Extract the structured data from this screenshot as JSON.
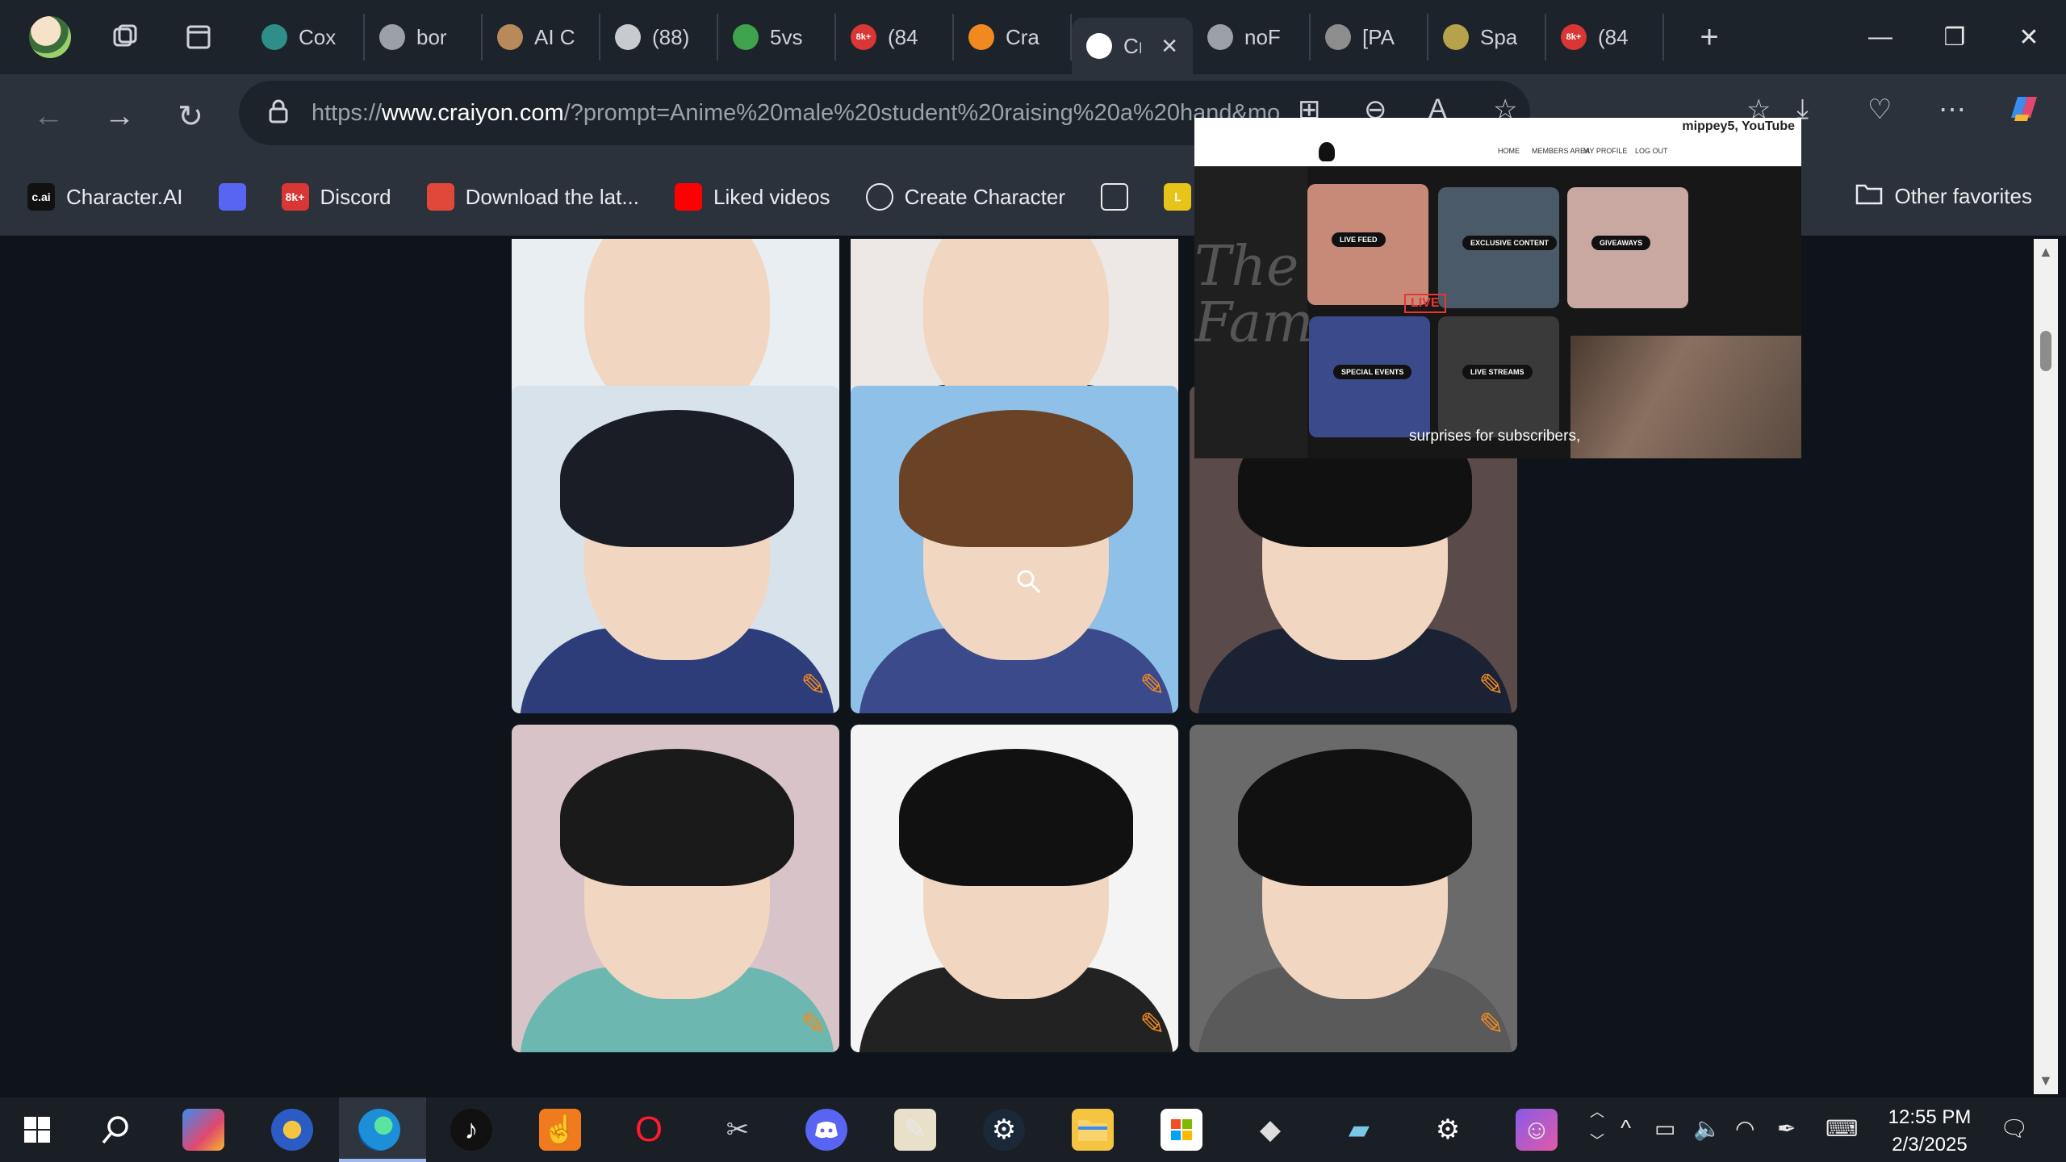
{
  "browser": {
    "tabs": [
      {
        "label": "Cox",
        "icon": "circle-icon",
        "color": "#2f8f88"
      },
      {
        "label": "bor",
        "icon": "document-icon",
        "color": "#9aa0a6"
      },
      {
        "label": "AI C",
        "icon": "avatar-icon",
        "color": "#b88a5a"
      },
      {
        "label": "(88)",
        "icon": "video-icon",
        "color": "#c7cbd0"
      },
      {
        "label": "5vs",
        "icon": "pinwheel-icon",
        "color": "#3fa34d"
      },
      {
        "label": "(84",
        "icon": "badge-icon",
        "color": "#d93636",
        "badge": "8k+"
      },
      {
        "label": "Cra",
        "icon": "pencil-icon",
        "color": "#f08a20"
      },
      {
        "label": "Cr",
        "icon": "tab-icon",
        "color": "#ffffff",
        "active": true
      },
      {
        "label": "noF",
        "icon": "document-icon",
        "color": "#9aa0a6"
      },
      {
        "label": "[PA",
        "icon": "game-icon",
        "color": "#8d8d8d"
      },
      {
        "label": "Spa",
        "icon": "avatar-icon",
        "color": "#b5a24a"
      },
      {
        "label": "(84",
        "icon": "badge-icon",
        "color": "#d93636",
        "badge": "8k+"
      }
    ],
    "new_tab": "+",
    "url_scheme": "https://",
    "url_host": "www.craiyon.com",
    "url_path": "/?prompt=Anime%20male%20student%20raising%20a%20hand&mo",
    "favorites": [
      {
        "label": "Character.AI",
        "icon": "cai-icon",
        "badge": "c.ai"
      },
      {
        "label": "",
        "icon": "discord-icon"
      },
      {
        "label": "Discord",
        "icon": "badge-icon",
        "badge": "8k+"
      },
      {
        "label": "Download the lat...",
        "icon": "store-icon"
      },
      {
        "label": "Liked videos",
        "icon": "youtube-icon"
      },
      {
        "label": "Create Character",
        "icon": "create-icon"
      },
      {
        "label": "",
        "icon": "document-icon"
      },
      {
        "label": "",
        "icon": "y-icon"
      }
    ],
    "other_favorites": "Other favorites"
  },
  "pip": {
    "channel": "mippey5, YouTube",
    "nav": [
      "HOME",
      "MEMBERS AREA",
      "MY PROFILE",
      "LOG OUT"
    ],
    "big_text": "The Ac\nFam",
    "cards": [
      "LIVE FEED",
      "EXCLUSIVE CONTENT",
      "GIVEAWAYS",
      "SPECIAL EVENTS",
      "LIVE STREAMS"
    ],
    "live_badge": "LIVE",
    "caption": "surprises for subscribers,"
  },
  "gallery": {
    "rows": 3,
    "pencil_icon": "pencil-icon"
  },
  "taskbar": {
    "time": "12:55 PM",
    "date": "2/3/2025"
  }
}
